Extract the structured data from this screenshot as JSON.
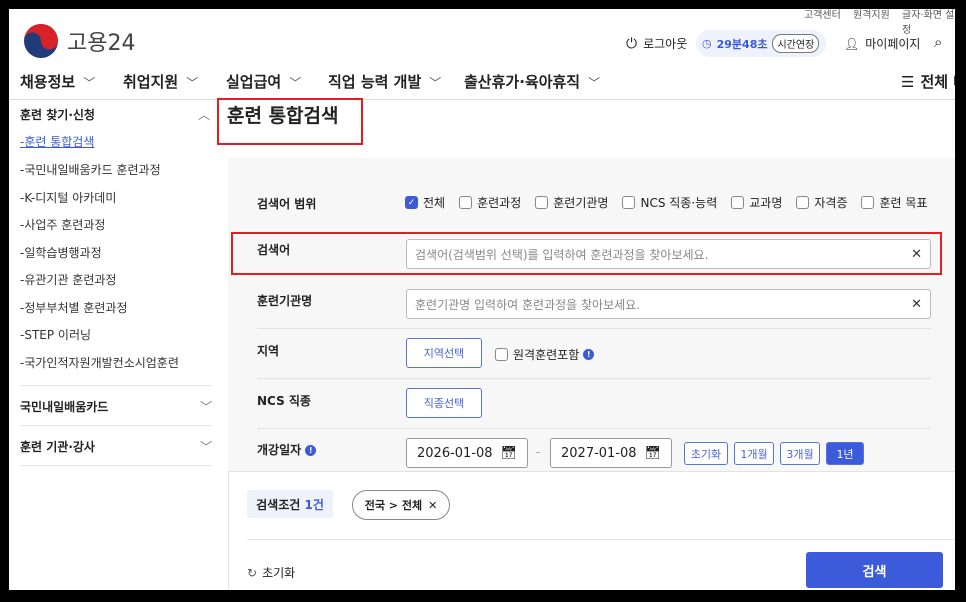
{
  "header": {
    "logo_text": "고용24",
    "utility_links": [
      "고객센터",
      "원격지원",
      "글자·화면 설정"
    ],
    "logout": "로그아웃",
    "timer": "29분48초",
    "extend": "시간연장",
    "mypage": "마이페이지",
    "all_menu": "전체 메뉴"
  },
  "nav": [
    "채용정보",
    "취업지원",
    "실업급여",
    "직업 능력 개발",
    "출산휴가·육아휴직"
  ],
  "sidebar": {
    "section1": "훈련 찾기·신청",
    "items": [
      "-훈련 통합검색",
      "-국민내일배움카드 훈련과정",
      "-K-디지털 아카데미",
      "-사업주 훈련과정",
      "-일학습병행과정",
      "-유관기관 훈련과정",
      "-정부부처별 훈련과정",
      "-STEP 이러닝",
      "-국가인적자원개발컨소시엄훈련"
    ],
    "section2": "국민내일배움카드",
    "section3": "훈련 기관·강사"
  },
  "main": {
    "title": "훈련 통합검색",
    "scope_label": "검색어 범위",
    "scope_options": [
      {
        "label": "전체",
        "checked": true
      },
      {
        "label": "훈련과정",
        "checked": false
      },
      {
        "label": "훈련기관명",
        "checked": false
      },
      {
        "label": "NCS 직종·능력",
        "checked": false
      },
      {
        "label": "교과명",
        "checked": false
      },
      {
        "label": "자격증",
        "checked": false
      },
      {
        "label": "훈련 목표",
        "checked": false
      }
    ],
    "keyword_label": "검색어",
    "keyword_placeholder": "검색어(검색범위 선택)를 입력하여 훈련과정을 찾아보세요.",
    "institution_label": "훈련기관명",
    "institution_placeholder": "훈련기관명 입력하여 훈련과정을 찾아보세요.",
    "region_label": "지역",
    "region_button": "지역선택",
    "remote_label": "원격훈련포함",
    "ncs_label": "NCS 직종",
    "ncs_button": "직종선택",
    "date_label": "개강일자",
    "date_from": "2026-01-08",
    "date_to": "2027-01-08",
    "date_sep": "-",
    "periods": [
      {
        "label": "초기화",
        "active": false
      },
      {
        "label": "1개월",
        "active": false
      },
      {
        "label": "3개월",
        "active": false
      },
      {
        "label": "1년",
        "active": true
      }
    ],
    "conditions_label": "검색조건",
    "conditions_count": "1건",
    "condition_tag": "전국 > 전체",
    "reset": "초기화",
    "search": "검색"
  },
  "colors": {
    "accent": "#3b5bdb",
    "highlight": "#e02020",
    "panel": "#f7f7f7"
  }
}
